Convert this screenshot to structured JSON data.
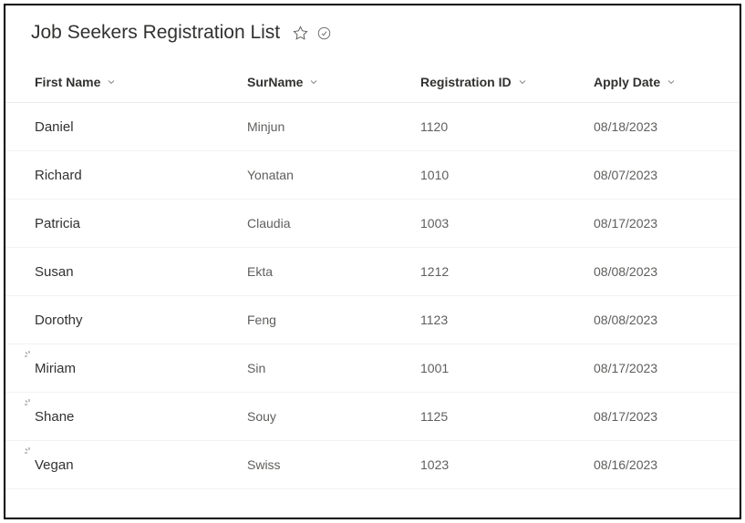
{
  "header": {
    "title": "Job Seekers Registration List"
  },
  "columns": {
    "firstName": "First Name",
    "surName": "SurName",
    "registrationId": "Registration ID",
    "applyDate": "Apply Date"
  },
  "rows": [
    {
      "firstName": "Daniel",
      "surName": "Minjun",
      "registrationId": "1120",
      "applyDate": "08/18/2023",
      "marked": false
    },
    {
      "firstName": "Richard",
      "surName": "Yonatan",
      "registrationId": "1010",
      "applyDate": "08/07/2023",
      "marked": false
    },
    {
      "firstName": "Patricia",
      "surName": "Claudia",
      "registrationId": "1003",
      "applyDate": "08/17/2023",
      "marked": false
    },
    {
      "firstName": "Susan",
      "surName": "Ekta",
      "registrationId": "1212",
      "applyDate": "08/08/2023",
      "marked": false
    },
    {
      "firstName": "Dorothy",
      "surName": "Feng",
      "registrationId": "1123",
      "applyDate": "08/08/2023",
      "marked": false
    },
    {
      "firstName": "Miriam",
      "surName": "Sin",
      "registrationId": "1001",
      "applyDate": "08/17/2023",
      "marked": true
    },
    {
      "firstName": "Shane",
      "surName": "Souy",
      "registrationId": "1125",
      "applyDate": "08/17/2023",
      "marked": true
    },
    {
      "firstName": "Vegan",
      "surName": "Swiss",
      "registrationId": "1023",
      "applyDate": "08/16/2023",
      "marked": true
    }
  ]
}
